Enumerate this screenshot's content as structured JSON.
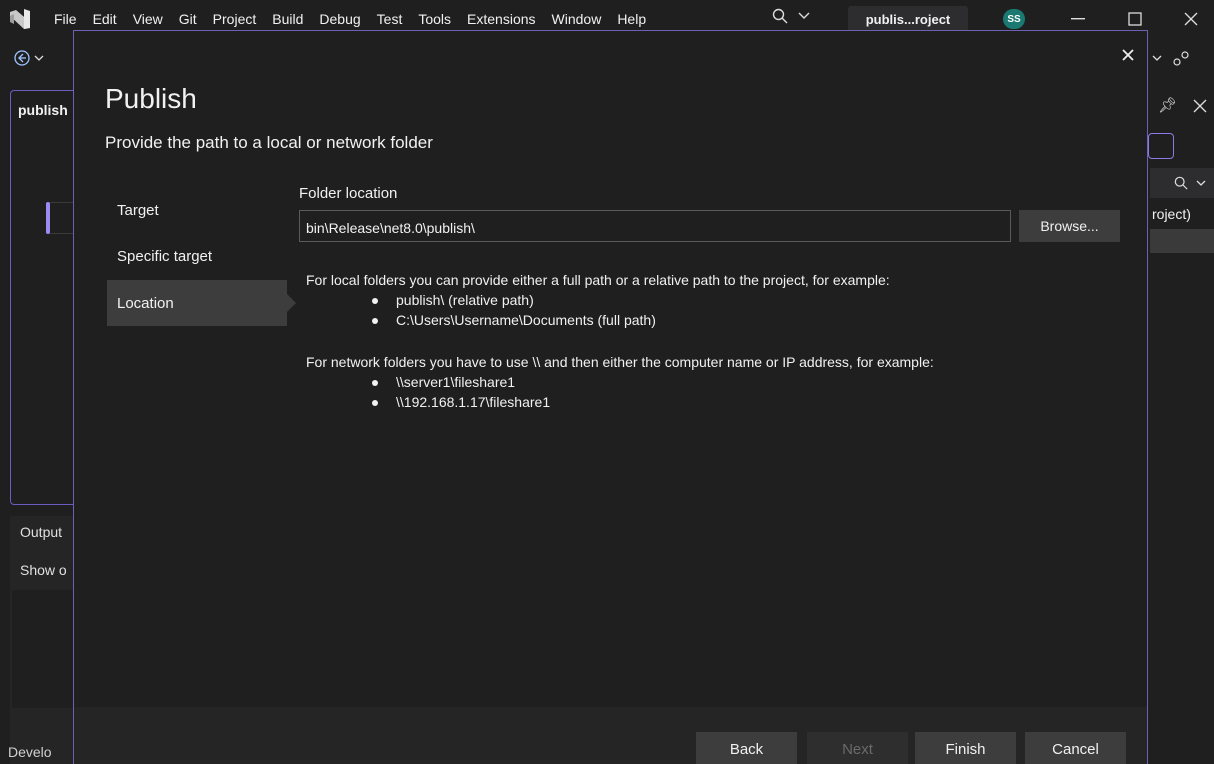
{
  "menu": {
    "items": [
      "File",
      "Edit",
      "View",
      "Git",
      "Project",
      "Build",
      "Debug",
      "Test",
      "Tools",
      "Extensions",
      "Window",
      "Help"
    ],
    "search_icon": "search-icon",
    "solution_name": "publis...roject",
    "avatar_initials": "SS"
  },
  "background": {
    "doc_tab": "publish",
    "output_title": "Output",
    "output_show": "Show o",
    "dev_label": "Develo",
    "right_label": "roject)"
  },
  "dialog": {
    "title": "Publish",
    "subtitle": "Provide the path to a local or network folder",
    "steps": [
      {
        "label": "Target",
        "active": false
      },
      {
        "label": "Specific target",
        "active": false
      },
      {
        "label": "Location",
        "active": true
      }
    ],
    "folder_label": "Folder location",
    "folder_value": "bin\\Release\\net8.0\\publish\\",
    "browse_label": "Browse...",
    "local_help": "For local folders you can provide either a full path or a relative path to the project, for example:",
    "local_examples": [
      "publish\\ (relative path)",
      "C:\\Users\\Username\\Documents (full path)"
    ],
    "network_help": "For network folders you have to use \\\\ and then either the computer name or IP address, for example:",
    "network_examples": [
      "\\\\server1\\fileshare1",
      "\\\\192.168.1.17\\fileshare1"
    ],
    "buttons": {
      "back": "Back",
      "next": "Next",
      "finish": "Finish",
      "cancel": "Cancel"
    }
  },
  "colors": {
    "accent": "#6b62b3",
    "background": "#1f1f1f",
    "avatar": "#1a7a72"
  }
}
